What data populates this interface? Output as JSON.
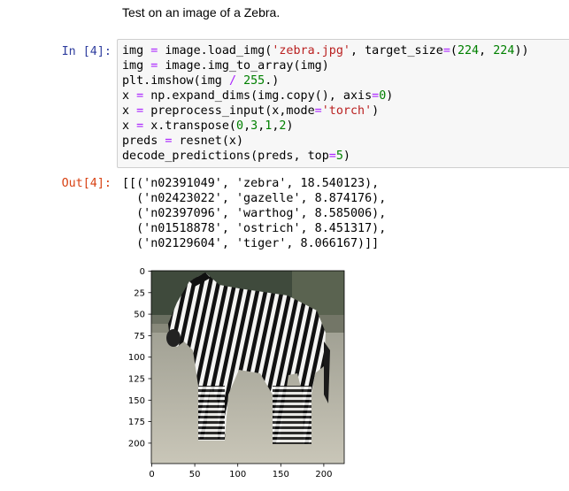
{
  "markdown": {
    "text": "Test on an image of a Zebra."
  },
  "cell": {
    "input_prompt": "In [4]:",
    "output_prompt": "Out[4]:",
    "code_lines": [
      "img = image.load_img('zebra.jpg', target_size=(224, 224))",
      "img = image.img_to_array(img)",
      "plt.imshow(img / 255.)",
      "x = np.expand_dims(img.copy(), axis=0)",
      "x = preprocess_input(x,mode='torch')",
      "x = x.transpose(0,3,1,2)",
      "preds = resnet(x)",
      "decode_predictions(preds, top=5)"
    ],
    "output_lines": [
      "[[('n02391049', 'zebra', 18.540123),",
      "  ('n02423022', 'gazelle', 8.874176),",
      "  ('n02397096', 'warthog', 8.585006),",
      "  ('n01518878', 'ostrich', 8.451317),",
      "  ('n02129604', 'tiger', 8.066167)]]"
    ]
  },
  "plot": {
    "image_subject": "zebra",
    "y_ticks": [
      "0",
      "25",
      "50",
      "75",
      "100",
      "125",
      "150",
      "175",
      "200"
    ],
    "x_ticks": [
      "0",
      "50",
      "100",
      "150",
      "200"
    ]
  },
  "colors": {
    "in_prompt": "#303f9f",
    "out_prompt": "#d84315",
    "string": "#ba2121",
    "number": "#008000",
    "operator": "#aa22ff"
  }
}
